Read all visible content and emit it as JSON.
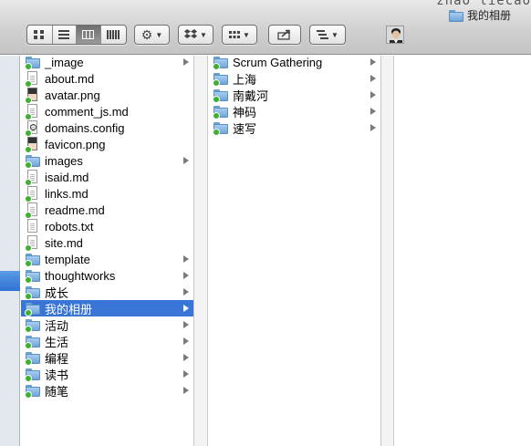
{
  "window": {
    "corner_text": "zhao liecao",
    "title": "我的相册"
  },
  "toolbar": {
    "view_buttons": [
      "icon-view-icon",
      "list-view-icon",
      "column-view-icon",
      "cover-flow-icon"
    ],
    "active_view": "column-view",
    "action_icon": "gear-icon",
    "dropbox_icon": "dropbox-icon",
    "arrange_icon": "arrange-grid-icon",
    "share_icon": "share-icon",
    "path_icon": "path-list-icon"
  },
  "columns": [
    {
      "items": [
        {
          "label": "_image",
          "kind": "folder",
          "has_children": true
        },
        {
          "label": "about.md",
          "kind": "file",
          "has_children": false
        },
        {
          "label": "avatar.png",
          "kind": "photo",
          "has_children": false
        },
        {
          "label": "comment_js.md",
          "kind": "file",
          "has_children": false
        },
        {
          "label": "domains.config",
          "kind": "config",
          "has_children": false
        },
        {
          "label": "favicon.png",
          "kind": "photo",
          "has_children": false
        },
        {
          "label": "images",
          "kind": "folder",
          "has_children": true
        },
        {
          "label": "isaid.md",
          "kind": "file",
          "has_children": false
        },
        {
          "label": "links.md",
          "kind": "file",
          "has_children": false
        },
        {
          "label": "readme.md",
          "kind": "file",
          "has_children": false
        },
        {
          "label": "robots.txt",
          "kind": "text",
          "has_children": false
        },
        {
          "label": "site.md",
          "kind": "file",
          "has_children": false
        },
        {
          "label": "template",
          "kind": "folder",
          "has_children": true
        },
        {
          "label": "thoughtworks",
          "kind": "folder",
          "has_children": true
        },
        {
          "label": "成长",
          "kind": "folder",
          "has_children": true
        },
        {
          "label": "我的相册",
          "kind": "folder",
          "has_children": true,
          "selected": true
        },
        {
          "label": "活动",
          "kind": "folder",
          "has_children": true
        },
        {
          "label": "生活",
          "kind": "folder",
          "has_children": true
        },
        {
          "label": "编程",
          "kind": "folder",
          "has_children": true
        },
        {
          "label": "读书",
          "kind": "folder",
          "has_children": true
        },
        {
          "label": "随笔",
          "kind": "folder",
          "has_children": true
        }
      ]
    },
    {
      "items": [
        {
          "label": "Scrum Gathering",
          "kind": "folder",
          "has_children": true
        },
        {
          "label": "上海",
          "kind": "folder",
          "has_children": true
        },
        {
          "label": "南戴河",
          "kind": "folder",
          "has_children": true
        },
        {
          "label": "神码",
          "kind": "folder",
          "has_children": true
        },
        {
          "label": "速写",
          "kind": "folder",
          "has_children": true
        }
      ]
    },
    {
      "items": []
    }
  ],
  "colors": {
    "selection": "#3875d7",
    "sync_badge": "#3db02f",
    "folder": "#6fa6d8"
  }
}
